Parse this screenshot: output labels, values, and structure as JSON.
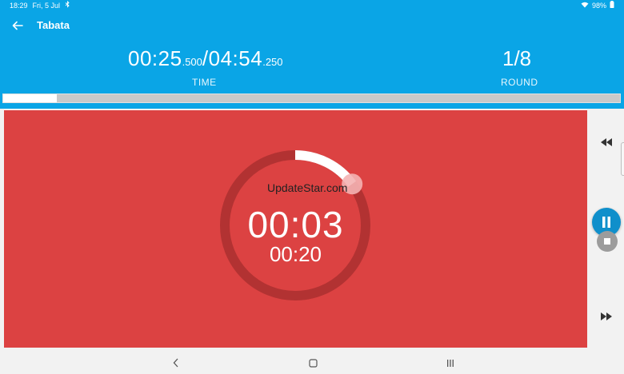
{
  "status_bar": {
    "time": "18:29",
    "date": "Fri, 5 Jul",
    "battery": "98%"
  },
  "app_bar": {
    "title": "Tabata"
  },
  "stats": {
    "elapsed_main": "00:25",
    "elapsed_ms": ".500",
    "separator": "/",
    "total_main": "04:54",
    "total_ms": ".250",
    "time_label": "TIME",
    "round": "1/8",
    "round_label": "ROUND"
  },
  "overall_progress": 0.087,
  "timer": {
    "countdown": "00:03",
    "interval": "00:20",
    "ring_progress": 0.15,
    "background_color": "#dc4242"
  },
  "watermark": "UpdateStar.com",
  "controls": {
    "rewind_icon": "rewind-icon",
    "fast_forward_icon": "fast-forward-icon",
    "pause_icon": "pause-icon",
    "stop_icon": "stop-icon"
  },
  "colors": {
    "header": "#0aa5e6",
    "accent": "#0f8fcb"
  }
}
